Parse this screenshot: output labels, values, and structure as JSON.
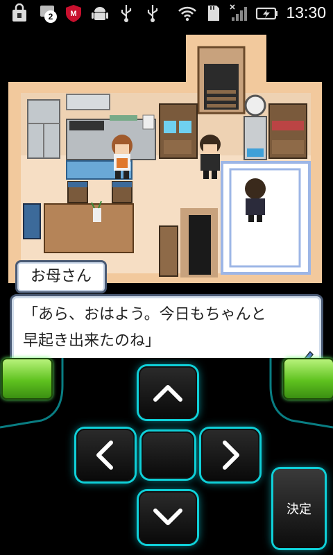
{
  "status_bar": {
    "time": "13:30",
    "notification_count": "2",
    "icons": [
      "shopping-bag-icon",
      "notification-icon",
      "mcafee-icon",
      "android-icon",
      "usb-icon",
      "usb-icon",
      "wifi-icon",
      "sd-card-icon",
      "signal-icon",
      "battery-charging-icon"
    ]
  },
  "dialogue": {
    "speaker": "お母さん",
    "text": "「あら、おはよう。今日もちゃんと\n早起き出来たのね」"
  },
  "controller": {
    "decide_label": "決定",
    "accent_color": "#0fd0d8",
    "side_button_color": "#5fc21f"
  }
}
